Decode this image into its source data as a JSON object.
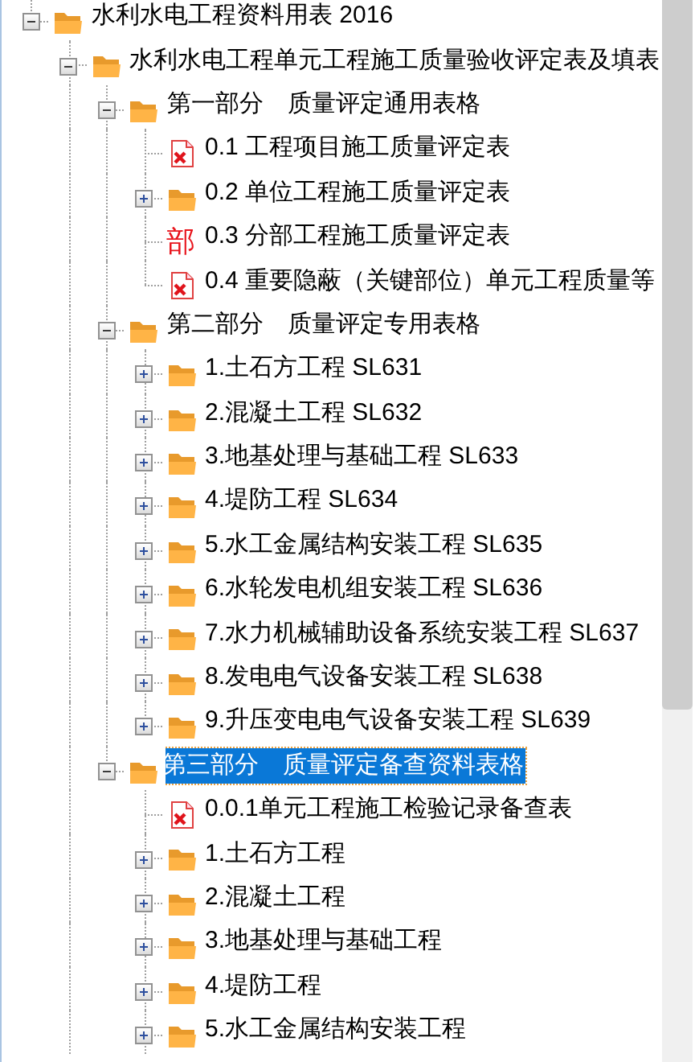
{
  "tree": [
    {
      "label": "水利水电工程资料用表 2016",
      "kind": "folder",
      "expanded": true,
      "selected": false,
      "children": [
        {
          "label": "水利水电工程单元工程施工质量验收评定表及填表",
          "kind": "folder",
          "expanded": true,
          "selected": false,
          "more_siblings_below": true,
          "children": [
            {
              "label": "第一部分　质量评定通用表格",
              "kind": "folder",
              "expanded": true,
              "selected": false,
              "children": [
                {
                  "label": "0.1 工程项目施工质量评定表",
                  "kind": "file",
                  "selected": false
                },
                {
                  "label": "0.2 单位工程施工质量评定表",
                  "kind": "folder",
                  "expanded": false,
                  "selected": false
                },
                {
                  "label": "0.3 分部工程施工质量评定表",
                  "kind": "glyph",
                  "glyph": "部",
                  "selected": false
                },
                {
                  "label": "0.4 重要隐蔽（关键部位）单元工程质量等",
                  "kind": "file",
                  "selected": false
                }
              ]
            },
            {
              "label": "第二部分　质量评定专用表格",
              "kind": "folder",
              "expanded": true,
              "selected": false,
              "children": [
                {
                  "label": "1.土石方工程 SL631",
                  "kind": "folder",
                  "expanded": false,
                  "selected": false
                },
                {
                  "label": "2.混凝土工程 SL632",
                  "kind": "folder",
                  "expanded": false,
                  "selected": false
                },
                {
                  "label": "3.地基处理与基础工程 SL633",
                  "kind": "folder",
                  "expanded": false,
                  "selected": false
                },
                {
                  "label": "4.堤防工程 SL634",
                  "kind": "folder",
                  "expanded": false,
                  "selected": false
                },
                {
                  "label": "5.水工金属结构安装工程 SL635",
                  "kind": "folder",
                  "expanded": false,
                  "selected": false
                },
                {
                  "label": "6.水轮发电机组安装工程 SL636",
                  "kind": "folder",
                  "expanded": false,
                  "selected": false
                },
                {
                  "label": "7.水力机械辅助设备系统安装工程 SL637",
                  "kind": "folder",
                  "expanded": false,
                  "selected": false
                },
                {
                  "label": "8.发电电气设备安装工程 SL638",
                  "kind": "folder",
                  "expanded": false,
                  "selected": false
                },
                {
                  "label": "9.升压变电电气设备安装工程 SL639",
                  "kind": "folder",
                  "expanded": false,
                  "selected": false
                }
              ]
            },
            {
              "label": "第三部分　质量评定备查资料表格",
              "kind": "folder",
              "expanded": true,
              "selected": true,
              "children": [
                {
                  "label": "0.0.1单元工程施工检验记录备查表",
                  "kind": "file",
                  "selected": false
                },
                {
                  "label": "1.土石方工程",
                  "kind": "folder",
                  "expanded": false,
                  "selected": false
                },
                {
                  "label": "2.混凝土工程",
                  "kind": "folder",
                  "expanded": false,
                  "selected": false
                },
                {
                  "label": "3.地基处理与基础工程",
                  "kind": "folder",
                  "expanded": false,
                  "selected": false
                },
                {
                  "label": "4.堤防工程",
                  "kind": "folder",
                  "expanded": false,
                  "selected": false
                },
                {
                  "label": "5.水工金属结构安装工程",
                  "kind": "folder",
                  "expanded": false,
                  "selected": false,
                  "more_siblings_below": true
                }
              ]
            }
          ]
        }
      ]
    }
  ]
}
